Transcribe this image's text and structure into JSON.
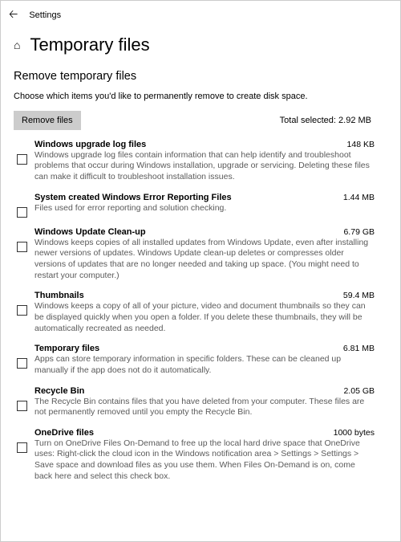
{
  "topbar": {
    "app_name": "Settings"
  },
  "page": {
    "title": "Temporary files",
    "section_title": "Remove temporary files",
    "section_desc": "Choose which items you'd like to permanently remove to create disk space.",
    "remove_button": "Remove files",
    "total_selected_label": "Total selected: 2.92 MB"
  },
  "items": [
    {
      "title": "Windows upgrade log files",
      "size": "148 KB",
      "desc": "Windows upgrade log files contain information that can help identify and troubleshoot problems that occur during Windows installation, upgrade or servicing. Deleting these files can make it difficult to troubleshoot installation issues."
    },
    {
      "title": "System created Windows Error Reporting Files",
      "size": "1.44 MB",
      "desc": "Files used for error reporting and solution checking."
    },
    {
      "title": "Windows Update Clean-up",
      "size": "6.79 GB",
      "desc": "Windows keeps copies of all installed updates from Windows Update, even after installing newer versions of updates. Windows Update clean-up deletes or compresses older versions of updates that are no longer needed and taking up space. (You might need to restart your computer.)"
    },
    {
      "title": "Thumbnails",
      "size": "59.4 MB",
      "desc": "Windows keeps a copy of all of your picture, video and document thumbnails so they can be displayed quickly when you open a folder. If you delete these thumbnails, they will be automatically recreated as needed."
    },
    {
      "title": "Temporary files",
      "size": "6.81 MB",
      "desc": "Apps can store temporary information in specific folders. These can be cleaned up manually if the app does not do it automatically."
    },
    {
      "title": "Recycle Bin",
      "size": "2.05 GB",
      "desc": "The Recycle Bin contains files that you have deleted from your computer. These files are not permanently removed until you empty the Recycle Bin."
    },
    {
      "title": "OneDrive files",
      "size": "1000 bytes",
      "desc": "Turn on OneDrive Files On-Demand to free up the local hard drive space that OneDrive uses: Right-click the cloud icon in the Windows notification area > Settings > Settings > Save space and download files as you use them. When Files On-Demand is on, come back here and select this check box."
    }
  ]
}
